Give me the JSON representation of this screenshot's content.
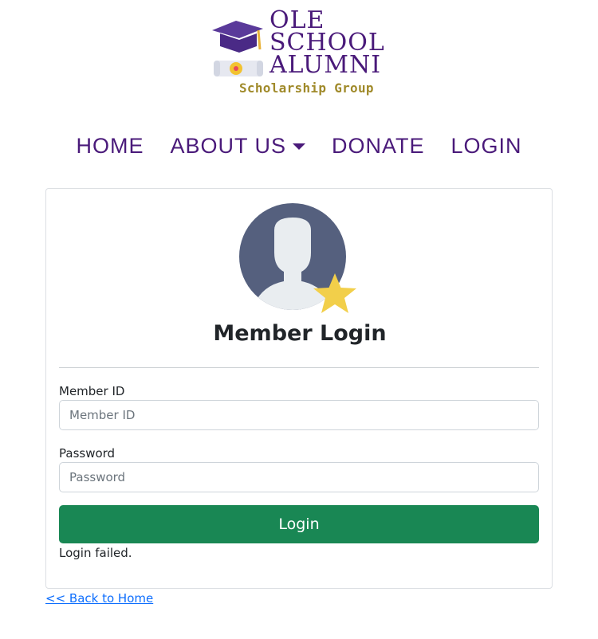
{
  "logo": {
    "brand_lines": [
      "OLE",
      "SCHOOL",
      "ALUMNI"
    ],
    "tagline": "Scholarship Group",
    "colors": {
      "purple": "#4a1a7a",
      "gold": "#a08a2a"
    }
  },
  "nav": {
    "home": "HOME",
    "about": "ABOUT US",
    "donate": "DONATE",
    "login": "LOGIN"
  },
  "card": {
    "title": "Member Login",
    "member_id_label": "Member ID",
    "member_id_placeholder": "Member ID",
    "member_id_value": "",
    "password_label": "Password",
    "password_placeholder": "Password",
    "password_value": "",
    "login_button": "Login",
    "status_message": "Login failed."
  },
  "footer": {
    "back_link": "<< Back to Home"
  },
  "colors": {
    "button": "#198754",
    "link": "#0d6efd",
    "nav": "#4a1a7a"
  },
  "icons": [
    "graduation-cap-icon",
    "diploma-icon",
    "user-avatar-icon",
    "star-icon",
    "caret-down-icon"
  ]
}
